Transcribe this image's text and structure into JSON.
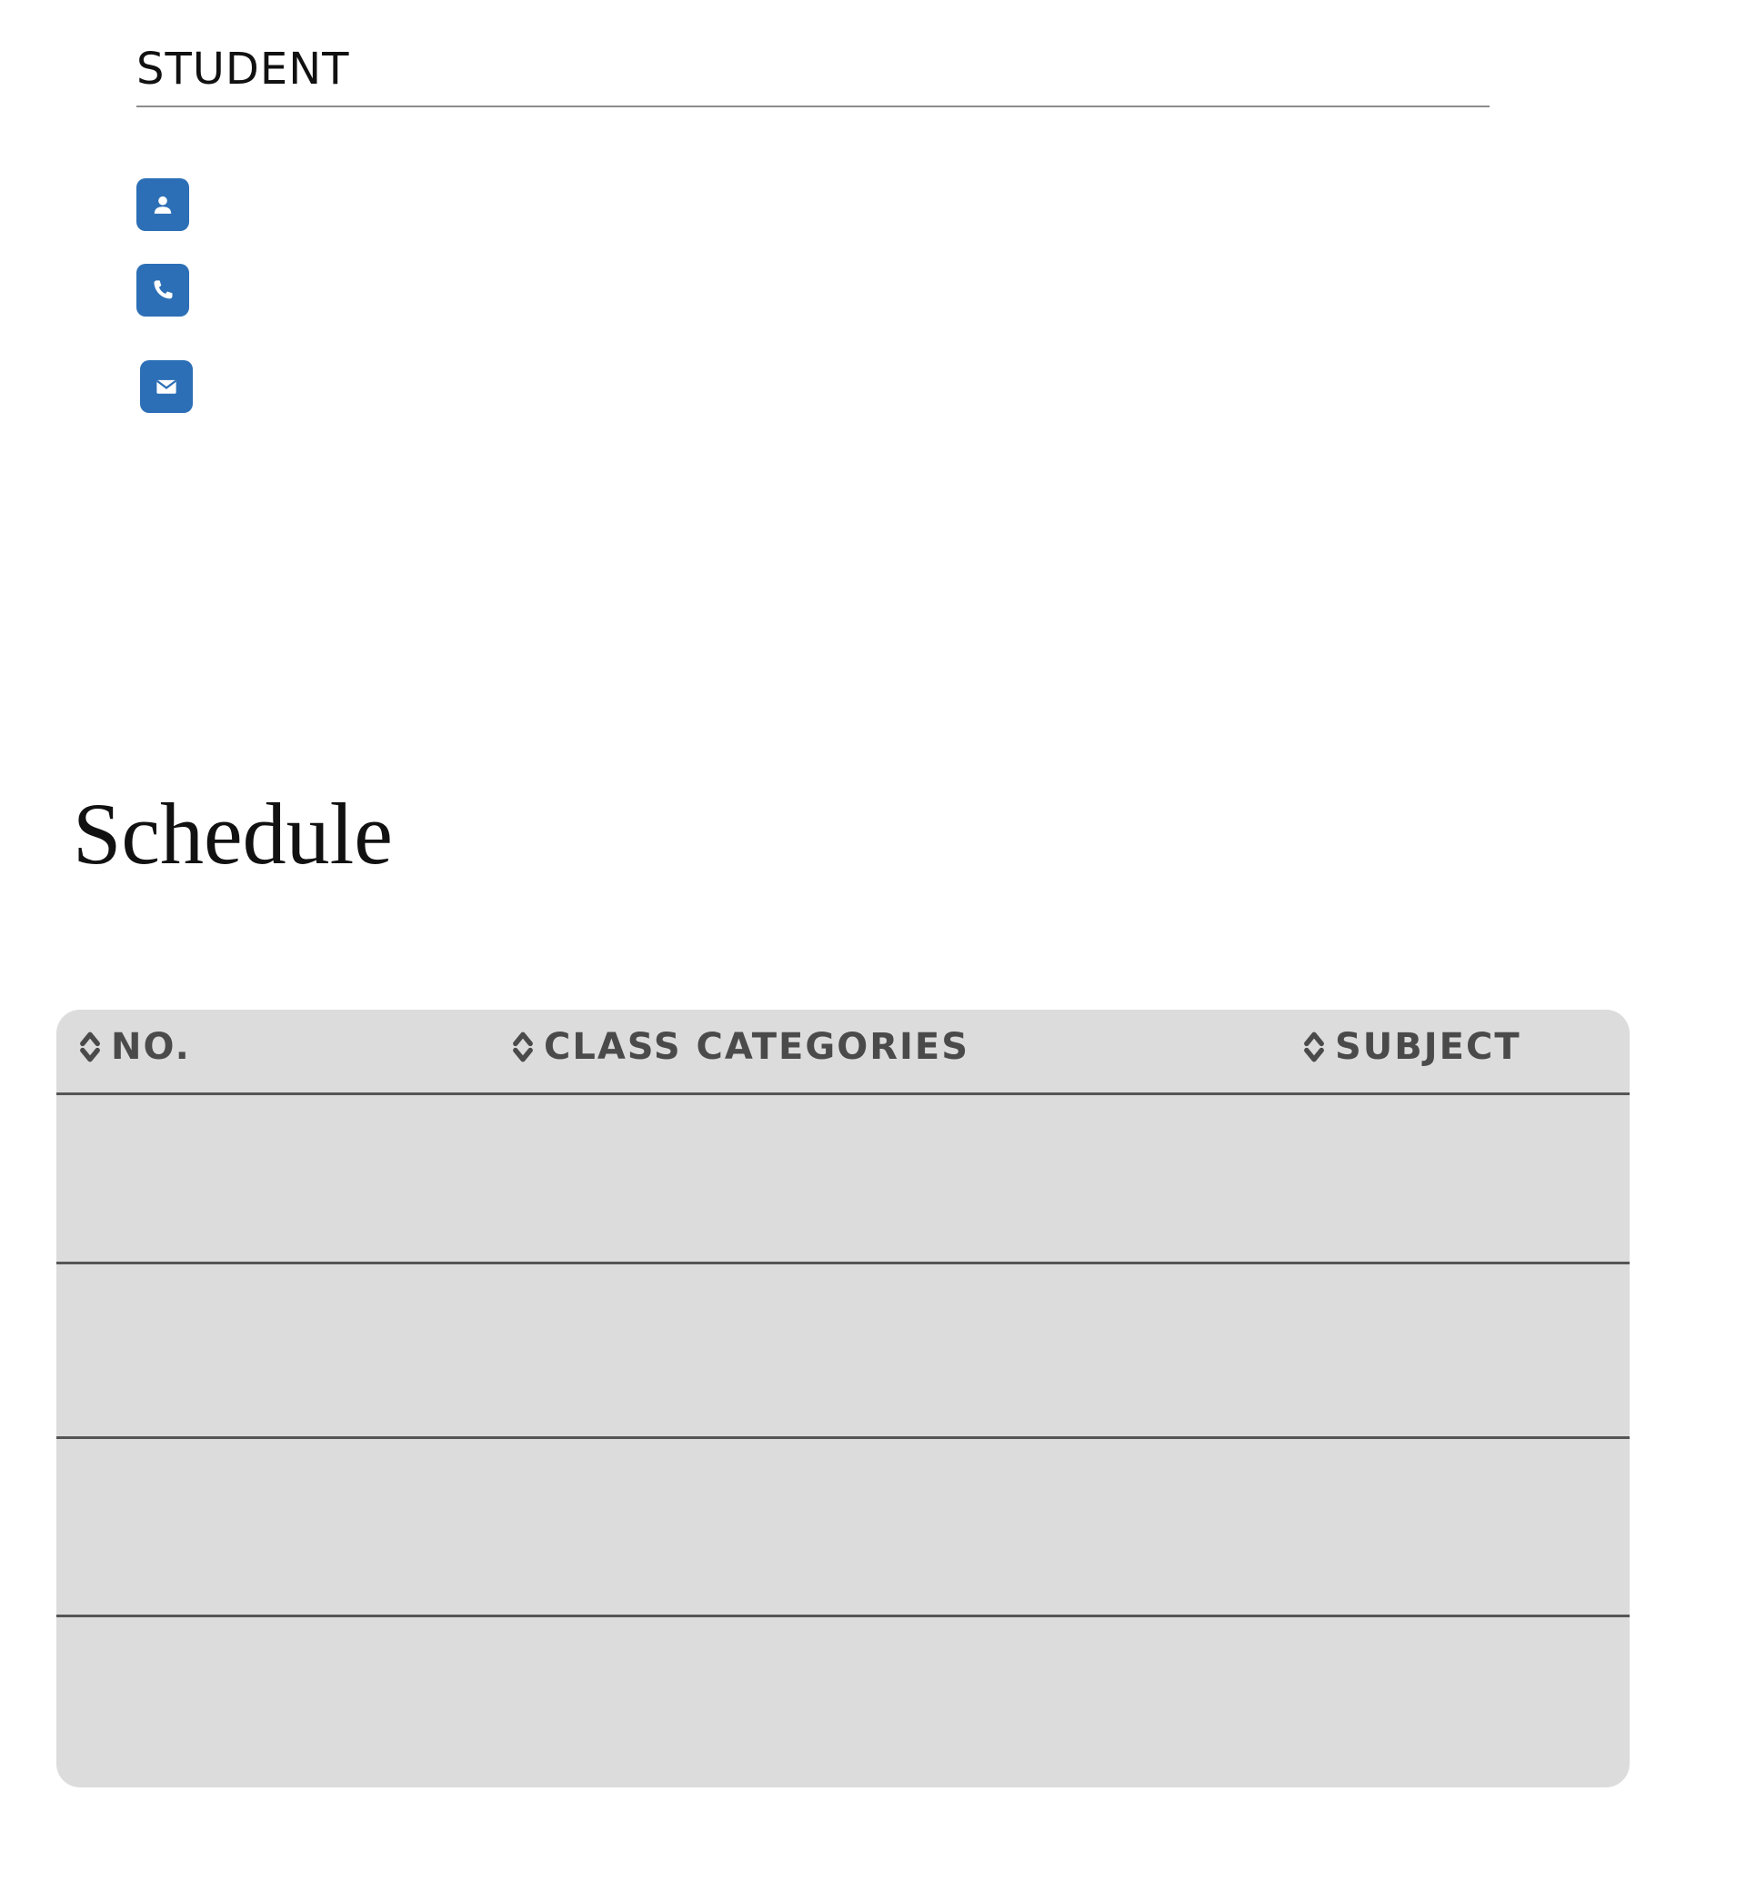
{
  "student": {
    "heading": "STUDENT",
    "contacts": [
      {
        "icon": "person-card-icon",
        "value": ""
      },
      {
        "icon": "phone-icon",
        "value": ""
      },
      {
        "icon": "mail-icon",
        "value": ""
      }
    ]
  },
  "schedule": {
    "title": "Schedule",
    "columns": [
      {
        "label": "NO.",
        "sort_icon": "sort-icon"
      },
      {
        "label": "CLASS CATEGORIES",
        "sort_icon": "sort-icon"
      },
      {
        "label": "SUBJECT",
        "sort_icon": "sort-icon"
      }
    ],
    "rows": [
      {
        "no": "",
        "category": "",
        "subject": ""
      },
      {
        "no": "",
        "category": "",
        "subject": ""
      },
      {
        "no": "",
        "category": "",
        "subject": ""
      },
      {
        "no": "",
        "category": "",
        "subject": ""
      }
    ]
  },
  "colors": {
    "accent": "#2c6fb6",
    "table_bg": "#dcdcdc",
    "header_text": "#4a4a4a",
    "divider": "#555555"
  }
}
